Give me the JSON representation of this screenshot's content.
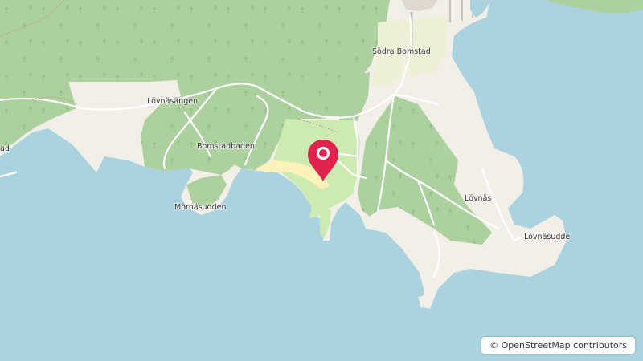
{
  "map": {
    "places": {
      "sodra_bomstad": "Södra Bomstad",
      "lovnasangen": "Lövnäsängen",
      "bomstadbaden": "Bomstadbaden",
      "mornasudden": "Mörnäsudden",
      "lovnas": "Lövnäs",
      "lovnasudde": "Lövnäsudde",
      "left_clipped": "ad"
    },
    "attribution": "© OpenStreetMap contributors",
    "colors": {
      "water": "#aad3df",
      "forest": "#add19e",
      "land": "#f2efe9",
      "farmland": "#eef0d5",
      "grass": "#cdebb0",
      "beach": "#fff1ba",
      "marker": "#e0224c"
    },
    "marker": "map-pin-icon"
  }
}
